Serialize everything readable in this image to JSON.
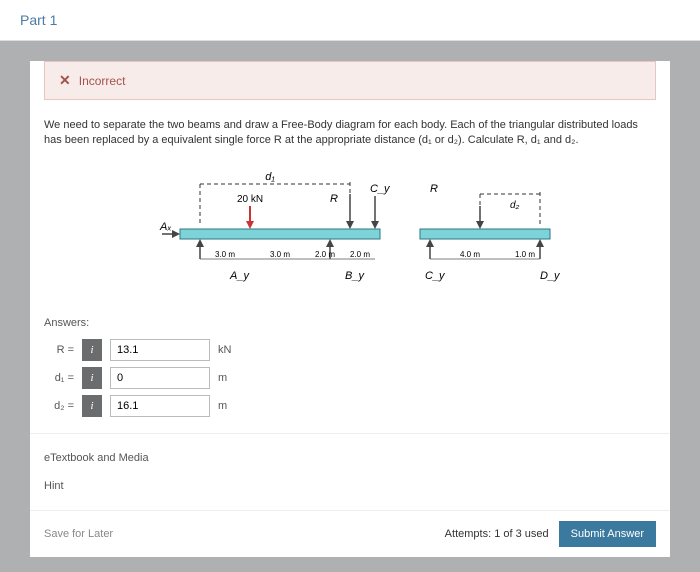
{
  "part_header": "Part 1",
  "alert": {
    "icon": "✕",
    "text": "Incorrect"
  },
  "problem": "We need to separate the two beams and draw a Free-Body diagram for each body. Each of the triangular distributed loads has been replaced by a equivalent single force R at the appropriate distance (d₁ or d₂). Calculate R, d₁ and d₂.",
  "diagram": {
    "d1": "d₁",
    "d2": "d₂",
    "load": "20 kN",
    "Ax": "Aₓ",
    "Ay": "A_y",
    "By": "B_y",
    "Cy": "C_y",
    "Dy": "D_y",
    "R": "R",
    "dim30a": "3.0 m",
    "dim30b": "3.0 m",
    "dim20a": "2.0 m",
    "dim20b": "2.0 m",
    "dim40": "4.0 m",
    "dim10": "1.0 m"
  },
  "answers_label": "Answers:",
  "rows": [
    {
      "label": "R =",
      "value": "13.1",
      "unit": "kN"
    },
    {
      "label": "d₁ =",
      "value": "0",
      "unit": "m"
    },
    {
      "label": "d₂ =",
      "value": "16.1",
      "unit": "m"
    }
  ],
  "links": {
    "etextbook": "eTextbook and Media",
    "hint": "Hint"
  },
  "footer": {
    "save": "Save for Later",
    "attempts": "Attempts: 1 of 3 used",
    "submit": "Submit Answer"
  }
}
